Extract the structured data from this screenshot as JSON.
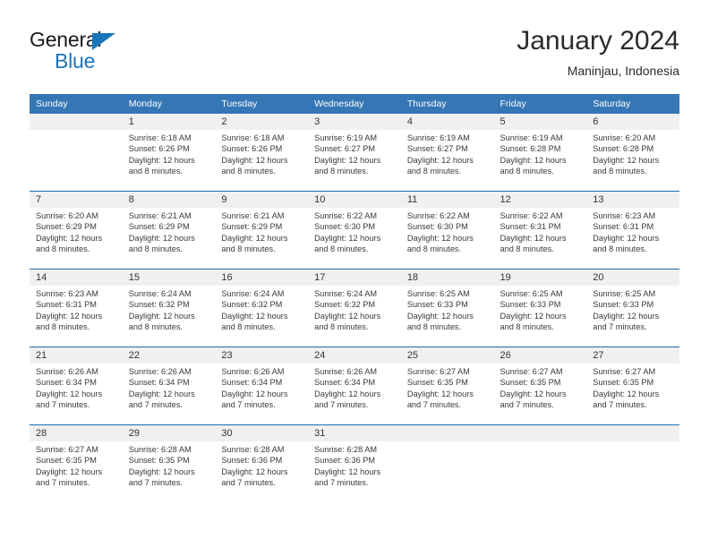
{
  "brand": {
    "line1": "General",
    "line2": "Blue",
    "triangle_color": "#1b75bb"
  },
  "header": {
    "title": "January 2024",
    "subtitle": "Maninjau, Indonesia"
  },
  "theme": {
    "header_bar": "#3576b5",
    "week_separator": "#1b6cb0",
    "daynum_band": "#f0f0f0",
    "text": "#3a3a3a"
  },
  "weekday_headers": [
    "Sunday",
    "Monday",
    "Tuesday",
    "Wednesday",
    "Thursday",
    "Friday",
    "Saturday"
  ],
  "weeks": [
    [
      {
        "day": "",
        "sunrise": "",
        "sunset": "",
        "daylight_1": "",
        "daylight_2": ""
      },
      {
        "day": "1",
        "sunrise": "Sunrise: 6:18 AM",
        "sunset": "Sunset: 6:26 PM",
        "daylight_1": "Daylight: 12 hours",
        "daylight_2": "and 8 minutes."
      },
      {
        "day": "2",
        "sunrise": "Sunrise: 6:18 AM",
        "sunset": "Sunset: 6:26 PM",
        "daylight_1": "Daylight: 12 hours",
        "daylight_2": "and 8 minutes."
      },
      {
        "day": "3",
        "sunrise": "Sunrise: 6:19 AM",
        "sunset": "Sunset: 6:27 PM",
        "daylight_1": "Daylight: 12 hours",
        "daylight_2": "and 8 minutes."
      },
      {
        "day": "4",
        "sunrise": "Sunrise: 6:19 AM",
        "sunset": "Sunset: 6:27 PM",
        "daylight_1": "Daylight: 12 hours",
        "daylight_2": "and 8 minutes."
      },
      {
        "day": "5",
        "sunrise": "Sunrise: 6:19 AM",
        "sunset": "Sunset: 6:28 PM",
        "daylight_1": "Daylight: 12 hours",
        "daylight_2": "and 8 minutes."
      },
      {
        "day": "6",
        "sunrise": "Sunrise: 6:20 AM",
        "sunset": "Sunset: 6:28 PM",
        "daylight_1": "Daylight: 12 hours",
        "daylight_2": "and 8 minutes."
      }
    ],
    [
      {
        "day": "7",
        "sunrise": "Sunrise: 6:20 AM",
        "sunset": "Sunset: 6:29 PM",
        "daylight_1": "Daylight: 12 hours",
        "daylight_2": "and 8 minutes."
      },
      {
        "day": "8",
        "sunrise": "Sunrise: 6:21 AM",
        "sunset": "Sunset: 6:29 PM",
        "daylight_1": "Daylight: 12 hours",
        "daylight_2": "and 8 minutes."
      },
      {
        "day": "9",
        "sunrise": "Sunrise: 6:21 AM",
        "sunset": "Sunset: 6:29 PM",
        "daylight_1": "Daylight: 12 hours",
        "daylight_2": "and 8 minutes."
      },
      {
        "day": "10",
        "sunrise": "Sunrise: 6:22 AM",
        "sunset": "Sunset: 6:30 PM",
        "daylight_1": "Daylight: 12 hours",
        "daylight_2": "and 8 minutes."
      },
      {
        "day": "11",
        "sunrise": "Sunrise: 6:22 AM",
        "sunset": "Sunset: 6:30 PM",
        "daylight_1": "Daylight: 12 hours",
        "daylight_2": "and 8 minutes."
      },
      {
        "day": "12",
        "sunrise": "Sunrise: 6:22 AM",
        "sunset": "Sunset: 6:31 PM",
        "daylight_1": "Daylight: 12 hours",
        "daylight_2": "and 8 minutes."
      },
      {
        "day": "13",
        "sunrise": "Sunrise: 6:23 AM",
        "sunset": "Sunset: 6:31 PM",
        "daylight_1": "Daylight: 12 hours",
        "daylight_2": "and 8 minutes."
      }
    ],
    [
      {
        "day": "14",
        "sunrise": "Sunrise: 6:23 AM",
        "sunset": "Sunset: 6:31 PM",
        "daylight_1": "Daylight: 12 hours",
        "daylight_2": "and 8 minutes."
      },
      {
        "day": "15",
        "sunrise": "Sunrise: 6:24 AM",
        "sunset": "Sunset: 6:32 PM",
        "daylight_1": "Daylight: 12 hours",
        "daylight_2": "and 8 minutes."
      },
      {
        "day": "16",
        "sunrise": "Sunrise: 6:24 AM",
        "sunset": "Sunset: 6:32 PM",
        "daylight_1": "Daylight: 12 hours",
        "daylight_2": "and 8 minutes."
      },
      {
        "day": "17",
        "sunrise": "Sunrise: 6:24 AM",
        "sunset": "Sunset: 6:32 PM",
        "daylight_1": "Daylight: 12 hours",
        "daylight_2": "and 8 minutes."
      },
      {
        "day": "18",
        "sunrise": "Sunrise: 6:25 AM",
        "sunset": "Sunset: 6:33 PM",
        "daylight_1": "Daylight: 12 hours",
        "daylight_2": "and 8 minutes."
      },
      {
        "day": "19",
        "sunrise": "Sunrise: 6:25 AM",
        "sunset": "Sunset: 6:33 PM",
        "daylight_1": "Daylight: 12 hours",
        "daylight_2": "and 8 minutes."
      },
      {
        "day": "20",
        "sunrise": "Sunrise: 6:25 AM",
        "sunset": "Sunset: 6:33 PM",
        "daylight_1": "Daylight: 12 hours",
        "daylight_2": "and 7 minutes."
      }
    ],
    [
      {
        "day": "21",
        "sunrise": "Sunrise: 6:26 AM",
        "sunset": "Sunset: 6:34 PM",
        "daylight_1": "Daylight: 12 hours",
        "daylight_2": "and 7 minutes."
      },
      {
        "day": "22",
        "sunrise": "Sunrise: 6:26 AM",
        "sunset": "Sunset: 6:34 PM",
        "daylight_1": "Daylight: 12 hours",
        "daylight_2": "and 7 minutes."
      },
      {
        "day": "23",
        "sunrise": "Sunrise: 6:26 AM",
        "sunset": "Sunset: 6:34 PM",
        "daylight_1": "Daylight: 12 hours",
        "daylight_2": "and 7 minutes."
      },
      {
        "day": "24",
        "sunrise": "Sunrise: 6:26 AM",
        "sunset": "Sunset: 6:34 PM",
        "daylight_1": "Daylight: 12 hours",
        "daylight_2": "and 7 minutes."
      },
      {
        "day": "25",
        "sunrise": "Sunrise: 6:27 AM",
        "sunset": "Sunset: 6:35 PM",
        "daylight_1": "Daylight: 12 hours",
        "daylight_2": "and 7 minutes."
      },
      {
        "day": "26",
        "sunrise": "Sunrise: 6:27 AM",
        "sunset": "Sunset: 6:35 PM",
        "daylight_1": "Daylight: 12 hours",
        "daylight_2": "and 7 minutes."
      },
      {
        "day": "27",
        "sunrise": "Sunrise: 6:27 AM",
        "sunset": "Sunset: 6:35 PM",
        "daylight_1": "Daylight: 12 hours",
        "daylight_2": "and 7 minutes."
      }
    ],
    [
      {
        "day": "28",
        "sunrise": "Sunrise: 6:27 AM",
        "sunset": "Sunset: 6:35 PM",
        "daylight_1": "Daylight: 12 hours",
        "daylight_2": "and 7 minutes."
      },
      {
        "day": "29",
        "sunrise": "Sunrise: 6:28 AM",
        "sunset": "Sunset: 6:35 PM",
        "daylight_1": "Daylight: 12 hours",
        "daylight_2": "and 7 minutes."
      },
      {
        "day": "30",
        "sunrise": "Sunrise: 6:28 AM",
        "sunset": "Sunset: 6:36 PM",
        "daylight_1": "Daylight: 12 hours",
        "daylight_2": "and 7 minutes."
      },
      {
        "day": "31",
        "sunrise": "Sunrise: 6:28 AM",
        "sunset": "Sunset: 6:36 PM",
        "daylight_1": "Daylight: 12 hours",
        "daylight_2": "and 7 minutes."
      },
      {
        "day": "",
        "sunrise": "",
        "sunset": "",
        "daylight_1": "",
        "daylight_2": ""
      },
      {
        "day": "",
        "sunrise": "",
        "sunset": "",
        "daylight_1": "",
        "daylight_2": ""
      },
      {
        "day": "",
        "sunrise": "",
        "sunset": "",
        "daylight_1": "",
        "daylight_2": ""
      }
    ]
  ]
}
